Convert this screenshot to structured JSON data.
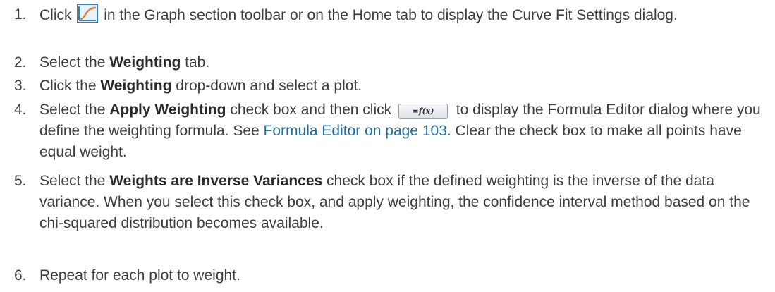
{
  "steps": [
    {
      "num": "1.",
      "pre": "Click ",
      "icon": "curve-fit-icon",
      "post": " in the Graph section toolbar or on the Home tab to display the Curve Fit Settings dialog."
    },
    {
      "num": "2.",
      "pre": "Select the ",
      "bold": "Weighting",
      "post": " tab."
    },
    {
      "num": "3.",
      "pre": "Click the ",
      "bold": "Weighting",
      "post": " drop-down and select a plot."
    },
    {
      "num": "4.",
      "pre": "Select the ",
      "bold": "Apply Weighting",
      "mid": " check box and then click ",
      "button_label": "=f(x)",
      "post": " to display the Formula Editor dialog where you define the weighting formula. See ",
      "link": "Formula Editor on page 103",
      "tail": ". Clear the check box to make all points have equal weight."
    },
    {
      "num": "5.",
      "pre": "Select the ",
      "bold": "Weights are Inverse Variances",
      "post": " check box if the defined weighting is the inverse of the data variance. When you select this check box, and apply weighting, the confidence interval method based on the chi-squared distribution becomes available."
    },
    {
      "num": "6.",
      "pre": "Repeat for each plot to weight."
    }
  ],
  "colors": {
    "text": "#3d3d3d",
    "link": "#1f6fa7",
    "icon_blue": "#2d7fc2",
    "icon_orange": "#e8733a"
  }
}
